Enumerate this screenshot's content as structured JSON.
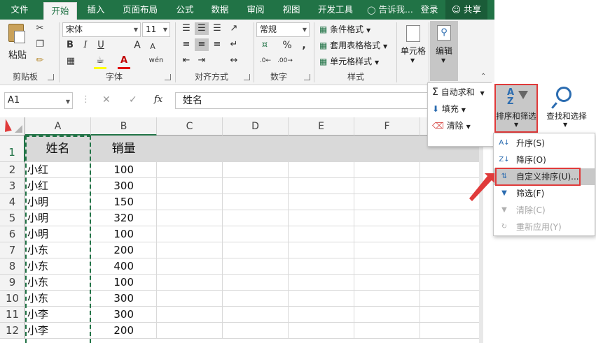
{
  "tabs": [
    "文件",
    "开始",
    "插入",
    "页面布局",
    "公式",
    "数据",
    "审阅",
    "视图",
    "开发工具"
  ],
  "tell_me": "告诉我...",
  "login": "登录",
  "share": "共享",
  "ribbon": {
    "clipboard": {
      "paste": "粘贴",
      "label": "剪贴板"
    },
    "font": {
      "name": "宋体",
      "size": "11",
      "bold": "B",
      "italic": "I",
      "underline": "U",
      "grow": "A",
      "shrink": "A",
      "wen": "wén",
      "label": "字体"
    },
    "align": {
      "label": "对齐方式"
    },
    "number": {
      "format": "常规",
      "percent": "%",
      "comma": ",",
      "label": "数字"
    },
    "styles": {
      "cond": "条件格式",
      "table": "套用表格格式",
      "cell": "单元格样式",
      "label": "样式"
    },
    "cells": {
      "label": "单元格"
    },
    "editing": {
      "label": "编辑"
    }
  },
  "formula_bar": {
    "name_box": "A1",
    "fx": "fx",
    "content": "姓名"
  },
  "columns": [
    "A",
    "B",
    "C",
    "D",
    "E",
    "F"
  ],
  "rows": [
    "1",
    "2",
    "3",
    "4",
    "5",
    "6",
    "7",
    "8",
    "9",
    "10",
    "11",
    "12"
  ],
  "table": {
    "header": [
      "姓名",
      "销量"
    ],
    "data": [
      [
        "小红",
        "100"
      ],
      [
        "小红",
        "300"
      ],
      [
        "小明",
        "150"
      ],
      [
        "小明",
        "320"
      ],
      [
        "小明",
        "100"
      ],
      [
        "小东",
        "200"
      ],
      [
        "小东",
        "400"
      ],
      [
        "小东",
        "100"
      ],
      [
        "小东",
        "300"
      ],
      [
        "小李",
        "300"
      ],
      [
        "小李",
        "200"
      ]
    ]
  },
  "edit_panel": {
    "autosum": "自动求和",
    "fill": "填充",
    "clear": "清除"
  },
  "sort_filter": {
    "sort_label": "排序和筛选",
    "find_label": "查找和选择"
  },
  "sort_menu": [
    {
      "label": "升序(S)",
      "disabled": false,
      "icon": "sort-asc-icon"
    },
    {
      "label": "降序(O)",
      "disabled": false,
      "icon": "sort-desc-icon"
    },
    {
      "label": "自定义排序(U)...",
      "disabled": false,
      "icon": "custom-sort-icon"
    },
    {
      "label": "筛选(F)",
      "disabled": false,
      "icon": "filter-icon"
    },
    {
      "label": "清除(C)",
      "disabled": true,
      "icon": "clear-filter-icon"
    },
    {
      "label": "重新应用(Y)",
      "disabled": true,
      "icon": "reapply-icon"
    }
  ],
  "colors": {
    "excel_green": "#217346",
    "highlight_red": "#e03a3a",
    "menu_hover": "#c8c8c8"
  }
}
